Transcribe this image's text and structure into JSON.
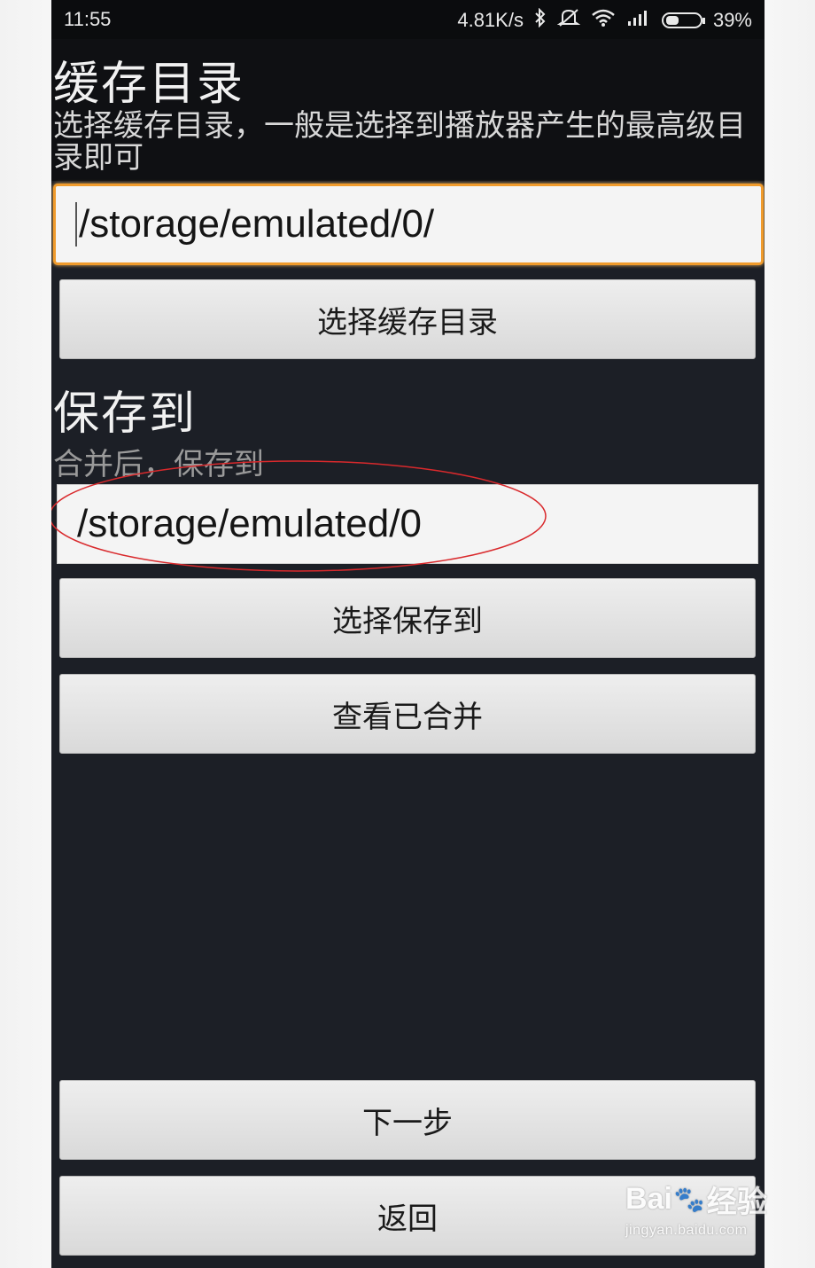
{
  "status_bar": {
    "time": "11:55",
    "speed": "4.81K/s",
    "battery": "39%",
    "icons": [
      "bluetooth-icon",
      "mute-icon",
      "wifi-icon",
      "signal-icon",
      "battery-icon"
    ]
  },
  "cache_section": {
    "title": "缓存目录",
    "subtitle": "选择缓存目录，一般是选择到播放器产生的最高级目录即可",
    "path_value": "/storage/emulated/0/",
    "select_button": "选择缓存目录"
  },
  "save_section": {
    "title": "保存到",
    "subtitle": "合并后，保存到",
    "path_value": "/storage/emulated/0",
    "select_button": "选择保存到",
    "view_button": "查看已合并"
  },
  "footer": {
    "next_button": "下一步",
    "back_button": "返回"
  },
  "watermark": {
    "logo": "Bai du 经验",
    "url": "jingyan.baidu.com"
  },
  "colors": {
    "app_background": "#1c1f26",
    "focus_border": "#f09b2c",
    "annotation_ellipse": "#d9292c"
  }
}
